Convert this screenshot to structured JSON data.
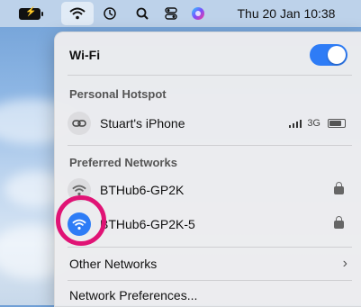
{
  "menubar": {
    "battery_icon": "battery-charging-icon",
    "wifi_icon": "wifi-icon",
    "timemachine_icon": "time-machine-icon",
    "search_icon": "spotlight-search-icon",
    "control_icon": "control-center-icon",
    "siri_icon": "siri-icon",
    "clock": "Thu 20 Jan  10:38"
  },
  "panel": {
    "title": "Wi-Fi",
    "toggle_on": true,
    "hotspot_section": "Personal Hotspot",
    "hotspot": {
      "name": "Stuart's iPhone",
      "signal": "3G"
    },
    "preferred_section": "Preferred Networks",
    "networks": [
      {
        "name": "BTHub6-GP2K",
        "connected": false
      },
      {
        "name": "BTHub6-GP2K-5",
        "connected": true
      }
    ],
    "other_networks": "Other Networks",
    "preferences": "Network Preferences..."
  },
  "colors": {
    "accent": "#2e7cf6",
    "highlight": "#e01375"
  }
}
